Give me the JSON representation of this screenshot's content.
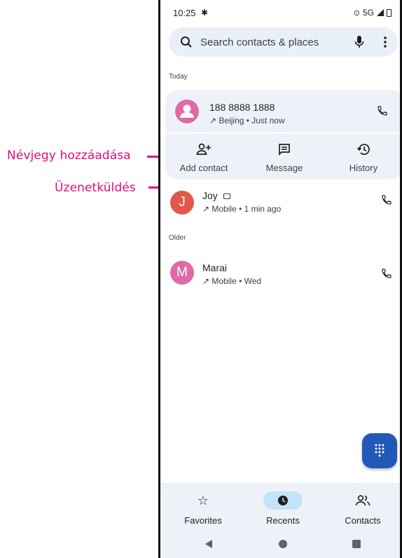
{
  "annotations": {
    "add_contact_callout": "Névjegy hozzáadása",
    "message_callout": "Üzenetküldés"
  },
  "status_bar": {
    "time": "10:25",
    "network": "5G"
  },
  "search": {
    "placeholder": "Search contacts & places"
  },
  "sections": {
    "today": "Today",
    "older": "Older"
  },
  "expanded_call": {
    "number": "188 8888 1888",
    "detail": "Beijing • Just now",
    "actions": [
      {
        "label": "Add contact",
        "icon": "add-person-icon"
      },
      {
        "label": "Message",
        "icon": "message-icon"
      },
      {
        "label": "History",
        "icon": "history-icon"
      }
    ]
  },
  "calls": [
    {
      "initial": "J",
      "name": "Joy",
      "detail": "Mobile • 1 min ago",
      "avatar_color": "#e2574c"
    },
    {
      "initial": "M",
      "name": "Marai",
      "detail": "Mobile • Wed",
      "avatar_color": "#e06aa8"
    }
  ],
  "bottom_nav": [
    {
      "label": "Favorites",
      "icon": "star-icon",
      "selected": false
    },
    {
      "label": "Recents",
      "icon": "clock-icon",
      "selected": true
    },
    {
      "label": "Contacts",
      "icon": "people-icon",
      "selected": false
    }
  ],
  "colors": {
    "accent": "#2059b8",
    "annotation": "#e5097f",
    "selected_pill": "#c2e4fb",
    "card": "#eef2f8"
  }
}
